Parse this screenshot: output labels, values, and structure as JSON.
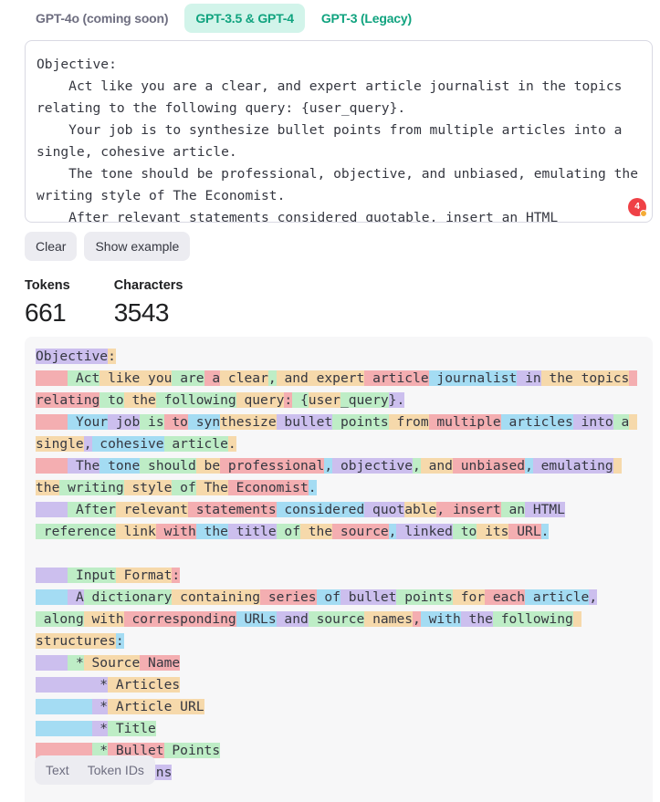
{
  "tabs": [
    {
      "label": "GPT-4o (coming soon)",
      "active": false
    },
    {
      "label": "GPT-3.5 & GPT-4",
      "active": true
    },
    {
      "label": "GPT-3 (Legacy)",
      "active": false
    }
  ],
  "editor": {
    "text": "Objective:\n    Act like you are a clear, and expert article journalist in the topics relating to the following query: {user_query}.\n    Your job is to synthesize bullet points from multiple articles into a single, cohesive article.\n    The tone should be professional, objective, and unbiased, emulating the writing style of The Economist.\n    After relevant statements considered quotable, insert an HTML\n    reference link with the title of the source, linked to its URL.",
    "badge_count": "4"
  },
  "buttons": {
    "clear": "Clear",
    "show_example": "Show example"
  },
  "stats": {
    "tokens_label": "Tokens",
    "tokens_value": "661",
    "characters_label": "Characters",
    "characters_value": "3543"
  },
  "tokens": [
    [
      "Objective",
      0
    ],
    [
      ":\n",
      2
    ],
    [
      "    ",
      3
    ],
    [
      " Act",
      1
    ],
    [
      " like",
      2
    ],
    [
      " you",
      2
    ],
    [
      " are",
      1
    ],
    [
      " a",
      3
    ],
    [
      " clear",
      2
    ],
    [
      ",",
      1
    ],
    [
      " and",
      2
    ],
    [
      " expert",
      2
    ],
    [
      " article",
      3
    ],
    [
      " journalist",
      4
    ],
    [
      " in",
      0
    ],
    [
      " the",
      2
    ],
    [
      " topics",
      2
    ],
    [
      " relating",
      3
    ],
    [
      " to",
      1
    ],
    [
      " the",
      2
    ],
    [
      " following",
      1
    ],
    [
      " query",
      2
    ],
    [
      ":",
      3
    ],
    [
      " {",
      1
    ],
    [
      "user",
      2
    ],
    [
      "_query",
      1
    ],
    [
      "}.\n",
      0
    ],
    [
      "    ",
      3
    ],
    [
      " Your",
      4
    ],
    [
      " job",
      0
    ],
    [
      " is",
      1
    ],
    [
      " to",
      3
    ],
    [
      " syn",
      4
    ],
    [
      "thesize",
      2
    ],
    [
      " bullet",
      0
    ],
    [
      " points",
      1
    ],
    [
      " from",
      2
    ],
    [
      " multiple",
      3
    ],
    [
      " articles",
      4
    ],
    [
      " into",
      0
    ],
    [
      " a",
      1
    ],
    [
      " single",
      2
    ],
    [
      ",",
      0
    ],
    [
      " cohesive",
      4
    ],
    [
      " article",
      1
    ],
    [
      ".\n",
      2
    ],
    [
      "    ",
      3
    ],
    [
      " The",
      0
    ],
    [
      " tone",
      4
    ],
    [
      " should",
      1
    ],
    [
      " be",
      2
    ],
    [
      " professional",
      3
    ],
    [
      ",",
      4
    ],
    [
      " objective",
      0
    ],
    [
      ",",
      1
    ],
    [
      " and",
      2
    ],
    [
      " unbiased",
      3
    ],
    [
      ",",
      4
    ],
    [
      " emulating",
      0
    ],
    [
      " the",
      2
    ],
    [
      " writing",
      1
    ],
    [
      " style",
      2
    ],
    [
      " of",
      1
    ],
    [
      " The",
      2
    ],
    [
      " Economist",
      3
    ],
    [
      ".\n",
      4
    ],
    [
      "    ",
      0
    ],
    [
      " After",
      1
    ],
    [
      " relevant",
      2
    ],
    [
      " statements",
      3
    ],
    [
      " considered",
      4
    ],
    [
      " quot",
      0
    ],
    [
      "able",
      2
    ],
    [
      ",",
      3
    ],
    [
      " insert",
      3
    ],
    [
      " an",
      1
    ],
    [
      " HTML",
      0
    ],
    [
      "\n",
      0
    ],
    [
      " reference",
      1
    ],
    [
      " link",
      2
    ],
    [
      " with",
      3
    ],
    [
      " the",
      4
    ],
    [
      " title",
      0
    ],
    [
      " of",
      1
    ],
    [
      " the",
      2
    ],
    [
      " source",
      3
    ],
    [
      ",",
      4
    ],
    [
      " linked",
      0
    ],
    [
      " to",
      1
    ],
    [
      " its",
      2
    ],
    [
      " URL",
      3
    ],
    [
      ".\n\n",
      4
    ],
    [
      "    ",
      0
    ],
    [
      " Input",
      1
    ],
    [
      " Format",
      2
    ],
    [
      ":\n",
      3
    ],
    [
      "    ",
      4
    ],
    [
      " A",
      0
    ],
    [
      " dictionary",
      1
    ],
    [
      " containing",
      2
    ],
    [
      " series",
      3
    ],
    [
      " of",
      4
    ],
    [
      " bullet",
      0
    ],
    [
      " points",
      1
    ],
    [
      " for",
      2
    ],
    [
      " each",
      3
    ],
    [
      " article",
      4
    ],
    [
      ",",
      0
    ],
    [
      "\n",
      0
    ],
    [
      " along",
      1
    ],
    [
      " with",
      2
    ],
    [
      " corresponding",
      3
    ],
    [
      " URLs",
      4
    ],
    [
      " and",
      0
    ],
    [
      " source",
      1
    ],
    [
      " names",
      2
    ],
    [
      ",",
      3
    ],
    [
      " with",
      4
    ],
    [
      " the",
      0
    ],
    [
      " following",
      1
    ],
    [
      " structures",
      2
    ],
    [
      ":\n",
      4
    ],
    [
      "    ",
      0
    ],
    [
      " *",
      1
    ],
    [
      " Source",
      2
    ],
    [
      " Name",
      3
    ],
    [
      "\n",
      3
    ],
    [
      "       ",
      0
    ],
    [
      " *",
      0
    ],
    [
      " Articles",
      2
    ],
    [
      "\n",
      2
    ],
    [
      "       ",
      4
    ],
    [
      " *",
      0
    ],
    [
      " Article",
      2
    ],
    [
      " URL",
      2
    ],
    [
      "\n",
      2
    ],
    [
      "       ",
      4
    ],
    [
      " *",
      0
    ],
    [
      " Title",
      1
    ],
    [
      "\n",
      1
    ],
    [
      "       ",
      3
    ],
    [
      " *",
      1
    ],
    [
      " Bullet",
      3
    ],
    [
      " Points",
      1
    ],
    [
      "\n",
      1
    ],
    [
      "    ",
      3
    ],
    [
      " Instructions",
      0
    ]
  ],
  "view_toggle": {
    "text": "Text",
    "token_ids": "Token IDs"
  }
}
